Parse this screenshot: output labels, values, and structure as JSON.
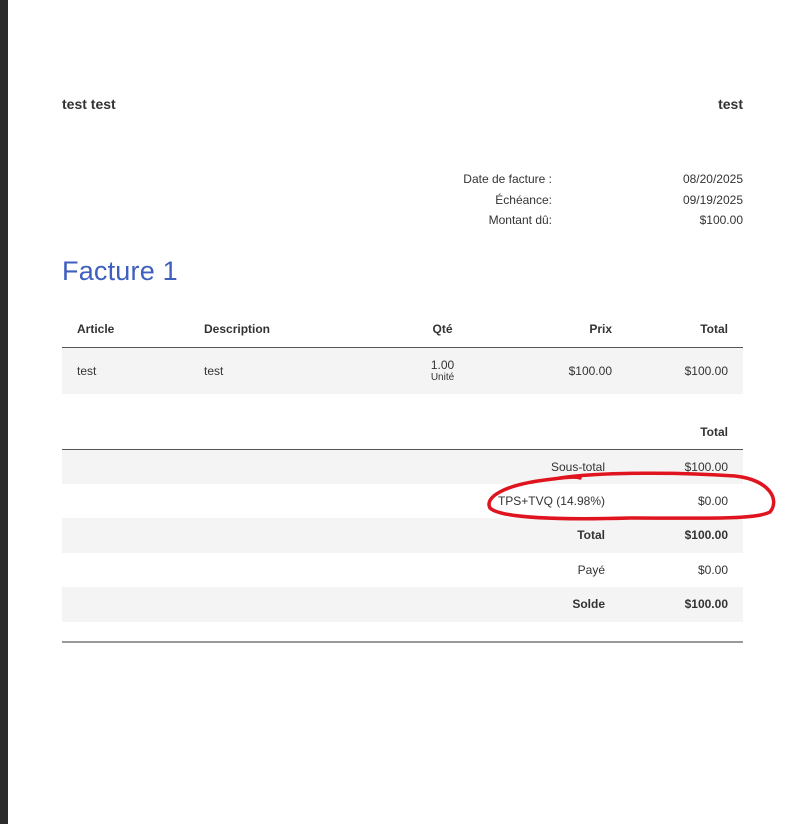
{
  "invoice": {
    "client_name": "test test",
    "company_name": "test",
    "meta": [
      {
        "label": "Date de facture :",
        "value": "08/20/2025"
      },
      {
        "label": "Échéance:",
        "value": "09/19/2025"
      },
      {
        "label": "Montant dû:",
        "value": "$100.00"
      }
    ],
    "title": "Facture 1",
    "columns": {
      "article": "Article",
      "description": "Description",
      "qty": "Qté",
      "price": "Prix",
      "total": "Total"
    },
    "line_items": [
      {
        "article": "test",
        "description": "test",
        "qty": "1.00",
        "unit": "Unité",
        "price": "$100.00",
        "total": "$100.00"
      }
    ],
    "totals_header": "Total",
    "totals": {
      "subtotal": {
        "label": "Sous-total",
        "value": "$100.00"
      },
      "tax": {
        "label": "TPS+TVQ (14.98%)",
        "value": "$0.00"
      },
      "total": {
        "label": "Total",
        "value": "$100.00"
      },
      "paid": {
        "label": "Payé",
        "value": "$0.00"
      },
      "balance": {
        "label": "Solde",
        "value": "$100.00"
      }
    }
  },
  "annotation": {
    "color": "#e0141e",
    "shape": "hand-drawn-ellipse"
  }
}
